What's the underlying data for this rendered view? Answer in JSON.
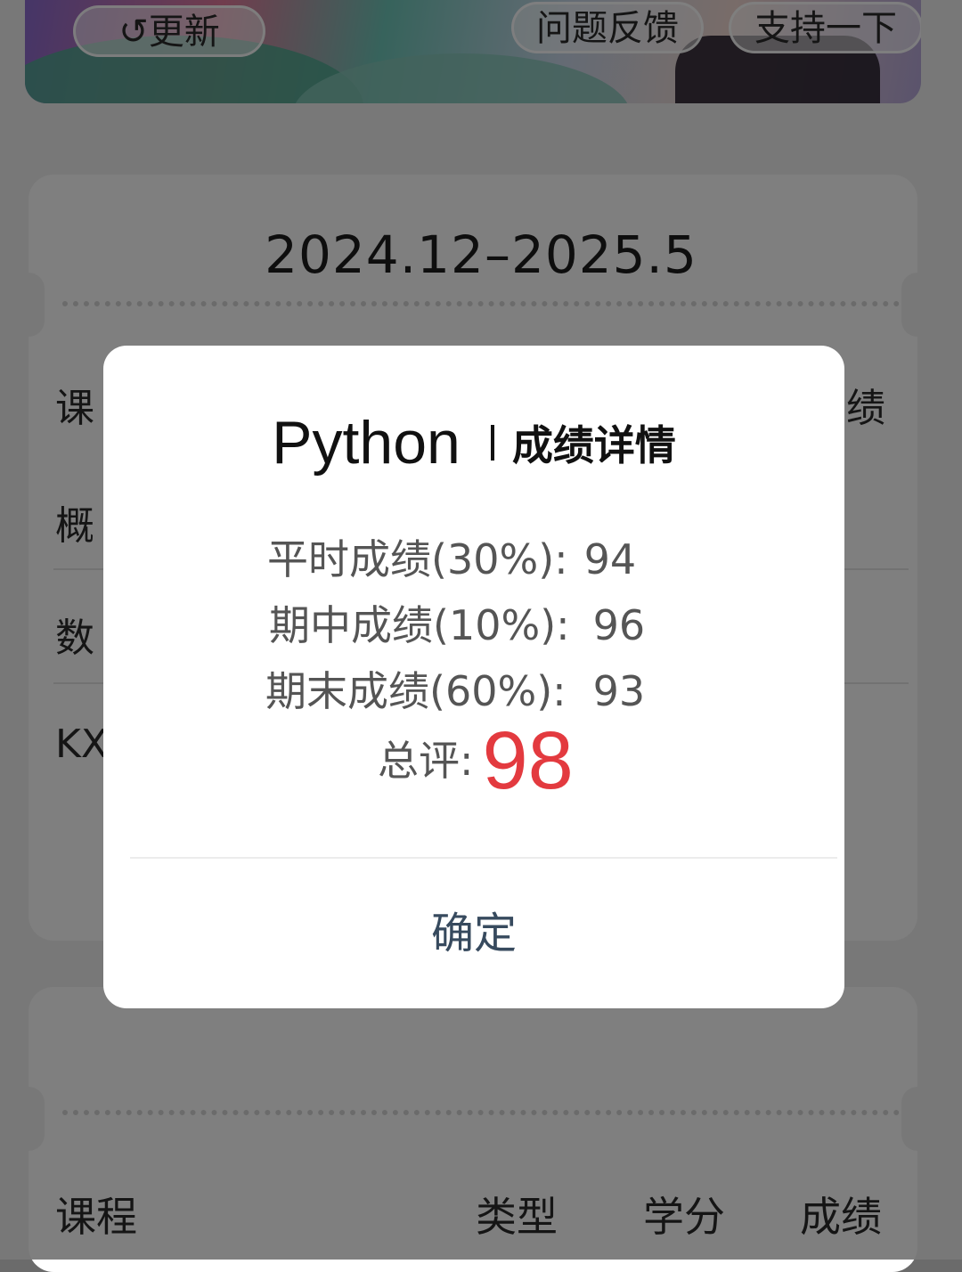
{
  "header": {
    "refresh_label": "↺更新",
    "feedback_label": "问题反馈",
    "support_label": "支持一下"
  },
  "term": {
    "title": "2024.12–2025.5",
    "rows_visible_fragments": [
      "课",
      "概",
      "数",
      "KX"
    ],
    "header_right_fragment": "绩"
  },
  "table_header": {
    "course": "课程",
    "type": "类型",
    "credit": "学分",
    "score": "成绩"
  },
  "modal": {
    "course_name": "Python",
    "subtitle": "成绩详情",
    "items": [
      {
        "label": "平时成绩(30%):",
        "value": "94"
      },
      {
        "label": "期中成绩(10%):",
        "value": "96"
      },
      {
        "label": "期末成绩(60%):",
        "value": "93"
      }
    ],
    "total_label": "总评:",
    "total_value": "98",
    "confirm_label": "确定"
  },
  "colors": {
    "total_value": "#e33a3f",
    "confirm_text": "#374a5e",
    "overlay": "rgba(0,0,0,0.5)"
  }
}
